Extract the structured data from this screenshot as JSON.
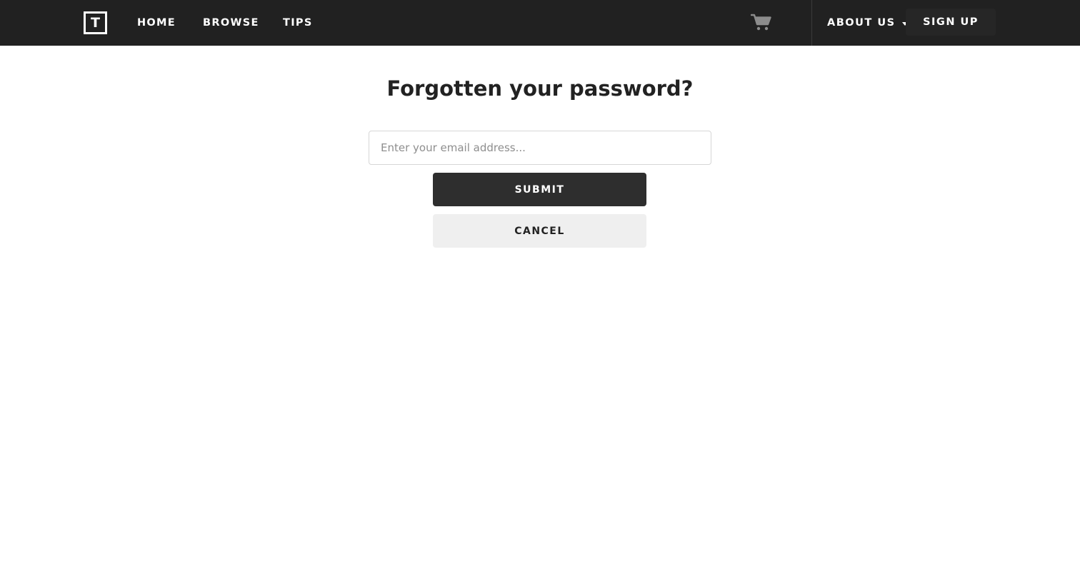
{
  "navbar": {
    "logo_letter": "T",
    "links": [
      {
        "label": "HOME"
      },
      {
        "label": "BROWSE"
      },
      {
        "label": "TIPS"
      }
    ],
    "cart_icon": "shopping-cart-icon",
    "about_label": "ABOUT US",
    "about_icon": "caret-down-icon",
    "signup_label": "SIGN UP"
  },
  "form": {
    "title": "Forgotten your password?",
    "email_value": "",
    "email_placeholder": "Enter your email address...",
    "submit_label": "SUBMIT",
    "cancel_label": "CANCEL"
  },
  "colors": {
    "navbar_bg": "#212121",
    "submit_bg": "#2e2e2e",
    "cancel_bg": "#efefef",
    "cart_icon": "#8c8c8c"
  }
}
